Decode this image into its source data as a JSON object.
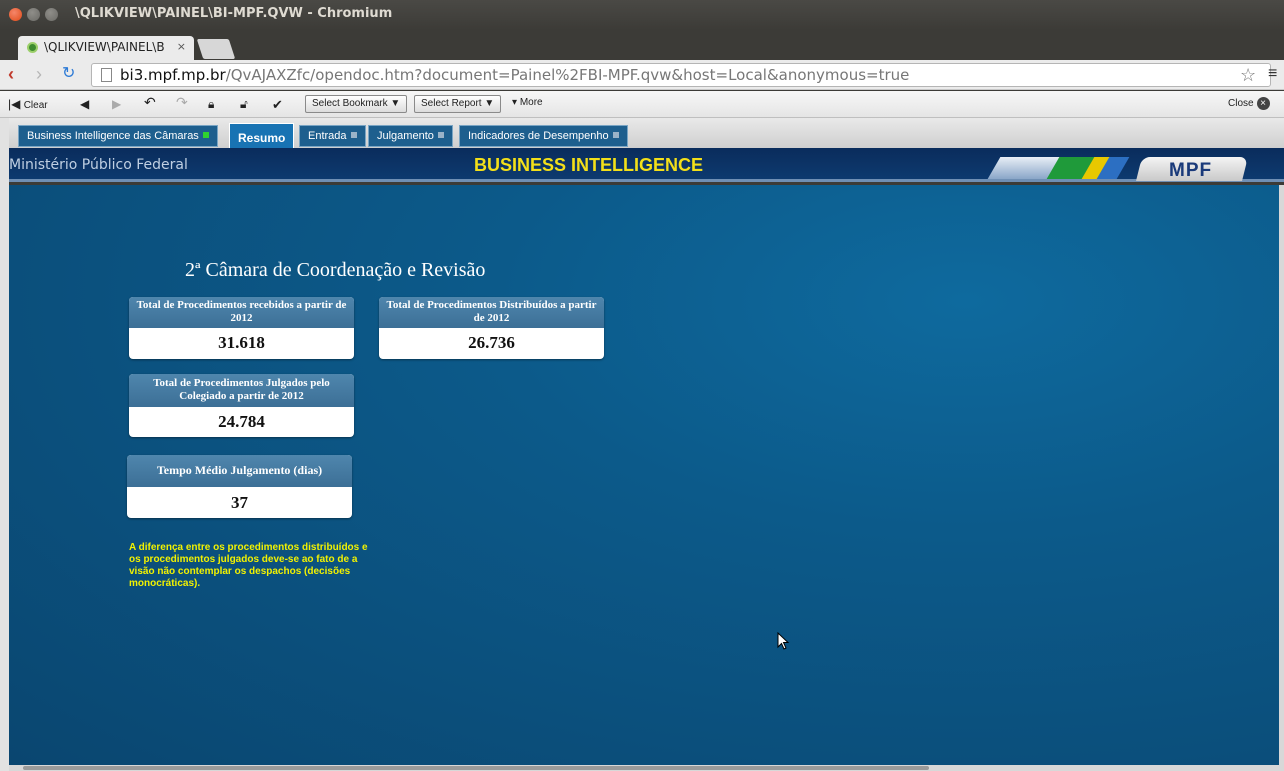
{
  "window": {
    "title": "\\QLIKVIEW\\PAINEL\\BI-MPF.QVW - Chromium"
  },
  "browser": {
    "tab_title": "\\QLIKVIEW\\PAINEL\\B",
    "tab_close": "×",
    "url_host": "bi3.mpf.mp.br",
    "url_path": "/QvAJAXZfc/opendoc.htm?document=Painel%2FBI-MPF.qvw&host=Local&anonymous=true"
  },
  "qv_toolbar": {
    "clear": "Clear",
    "select_bookmark": "Select Bookmark",
    "select_report": "Select Report",
    "more": "More",
    "close": "Close"
  },
  "sheet_tabs": [
    {
      "label": "Business Intelligence das Câmaras"
    },
    {
      "label": "Resumo"
    },
    {
      "label": "Entrada"
    },
    {
      "label": "Julgamento"
    },
    {
      "label": "Indicadores de Desempenho"
    }
  ],
  "banner": {
    "org": "Ministério Público Federal",
    "title": "BUSINESS INTELLIGENCE",
    "logo": "MPF",
    "colors": {
      "green": "#1f9a3a",
      "yellow": "#e8c800",
      "blue": "#2c6fc2"
    }
  },
  "main": {
    "heading": "2ª Câmara de Coordenação e Revisão",
    "kpis": [
      {
        "label": "Total de Procedimentos recebidos a partir de 2012",
        "value": "31.618"
      },
      {
        "label": "Total de Procedimentos Distribuídos a partir de 2012",
        "value": "26.736"
      },
      {
        "label": "Total de Procedimentos Julgados pelo Colegiado a partir de 2012",
        "value": "24.784"
      },
      {
        "label": "Tempo Médio Julgamento (dias)",
        "value": "37"
      }
    ],
    "note": "A diferença entre os procedimentos distribuídos e os procedimentos julgados deve-se ao fato de a visão não contemplar os despachos (decisões monocráticas)."
  }
}
